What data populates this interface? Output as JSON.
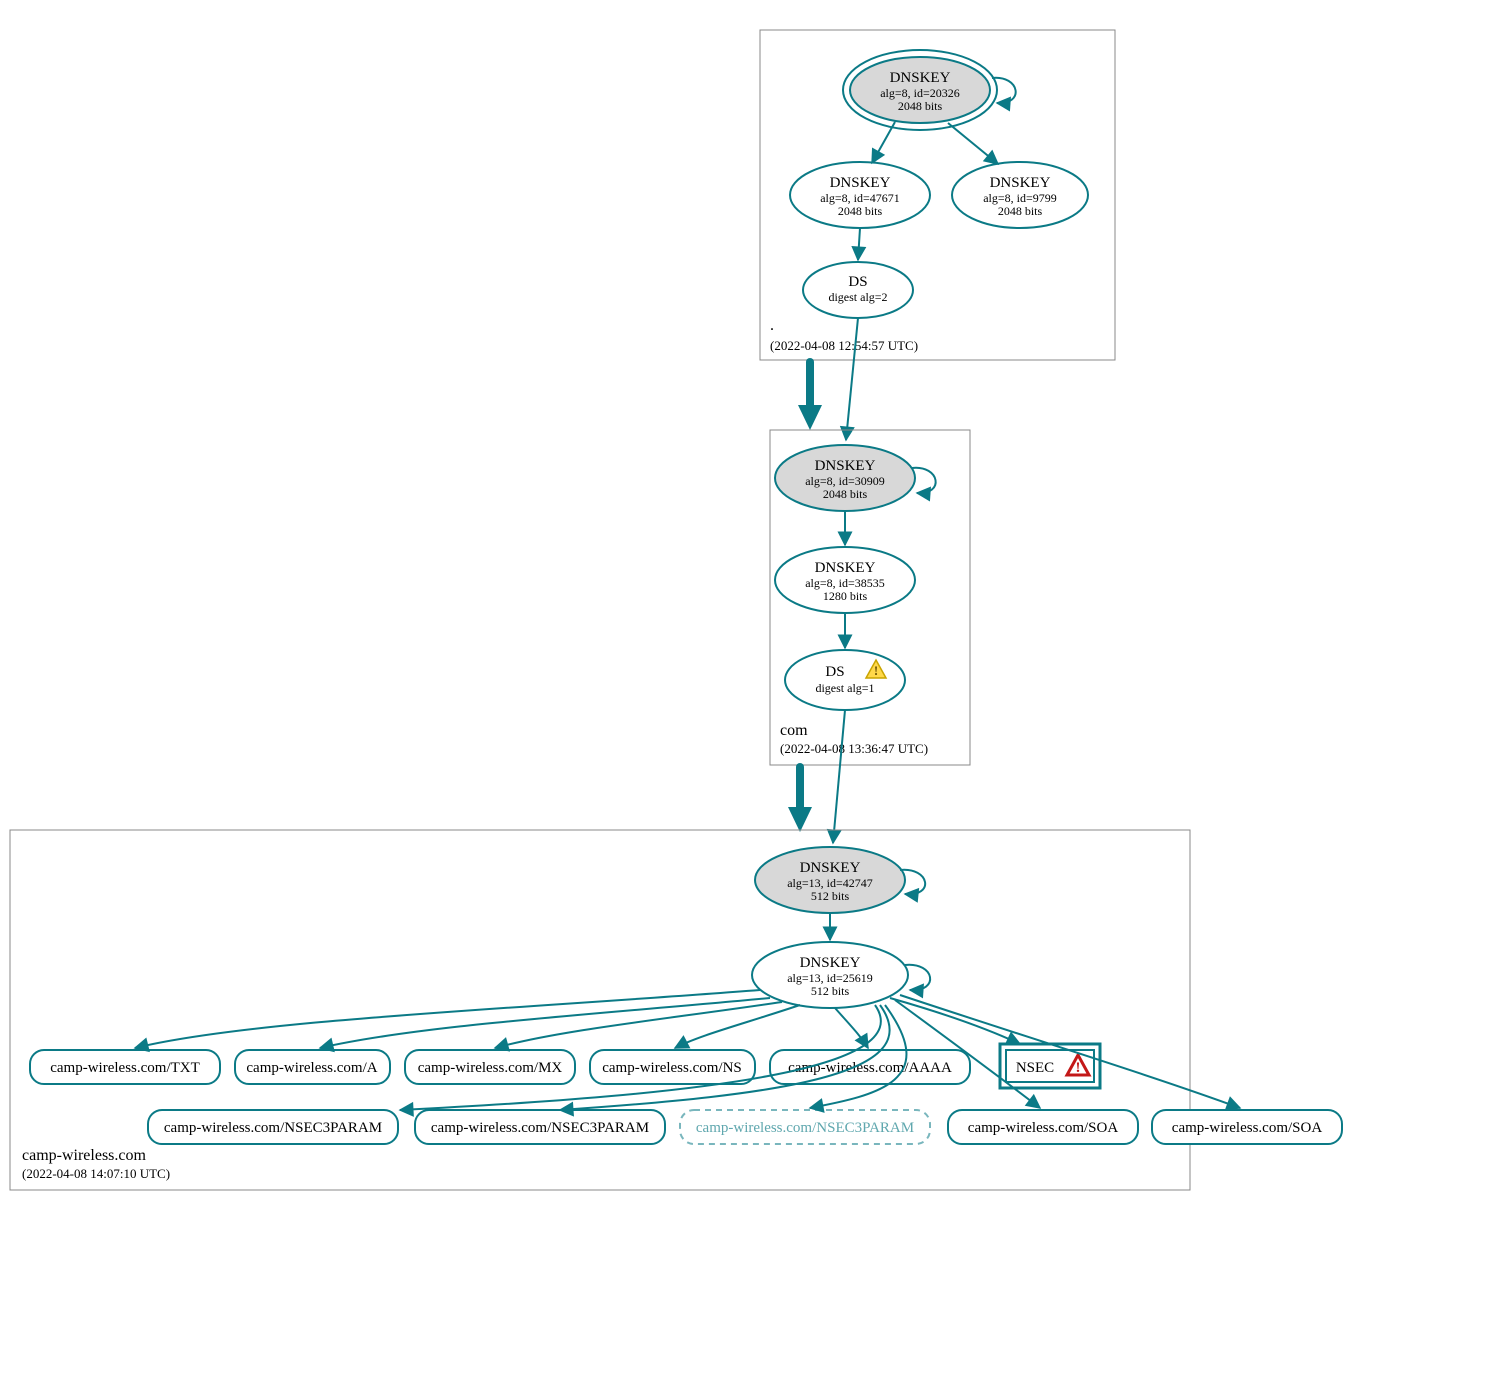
{
  "zones": {
    "root": {
      "name": ".",
      "timestamp": "(2022-04-08 12:54:57 UTC)",
      "ksk": {
        "title": "DNSKEY",
        "sub1": "alg=8, id=20326",
        "sub2": "2048 bits"
      },
      "zsk": {
        "title": "DNSKEY",
        "sub1": "alg=8, id=47671",
        "sub2": "2048 bits"
      },
      "extra": {
        "title": "DNSKEY",
        "sub1": "alg=8, id=9799",
        "sub2": "2048 bits"
      },
      "ds": {
        "title": "DS",
        "sub1": "digest alg=2"
      }
    },
    "com": {
      "name": "com",
      "timestamp": "(2022-04-08 13:36:47 UTC)",
      "ksk": {
        "title": "DNSKEY",
        "sub1": "alg=8, id=30909",
        "sub2": "2048 bits"
      },
      "zsk": {
        "title": "DNSKEY",
        "sub1": "alg=8, id=38535",
        "sub2": "1280 bits"
      },
      "ds": {
        "title": "DS",
        "sub1": "digest alg=1"
      }
    },
    "domain": {
      "name": "camp-wireless.com",
      "timestamp": "(2022-04-08 14:07:10 UTC)",
      "ksk": {
        "title": "DNSKEY",
        "sub1": "alg=13, id=42747",
        "sub2": "512 bits"
      },
      "zsk": {
        "title": "DNSKEY",
        "sub1": "alg=13, id=25619",
        "sub2": "512 bits"
      },
      "nsec": "NSEC",
      "rr": {
        "txt": "camp-wireless.com/TXT",
        "a": "camp-wireless.com/A",
        "mx": "camp-wireless.com/MX",
        "ns": "camp-wireless.com/NS",
        "aaaa": "camp-wireless.com/AAAA",
        "n3p1": "camp-wireless.com/NSEC3PARAM",
        "n3p2": "camp-wireless.com/NSEC3PARAM",
        "n3p3": "camp-wireless.com/NSEC3PARAM",
        "soa1": "camp-wireless.com/SOA",
        "soa2": "camp-wireless.com/SOA"
      }
    }
  },
  "icons": {
    "warn": "warning-icon",
    "err": "error-icon"
  }
}
